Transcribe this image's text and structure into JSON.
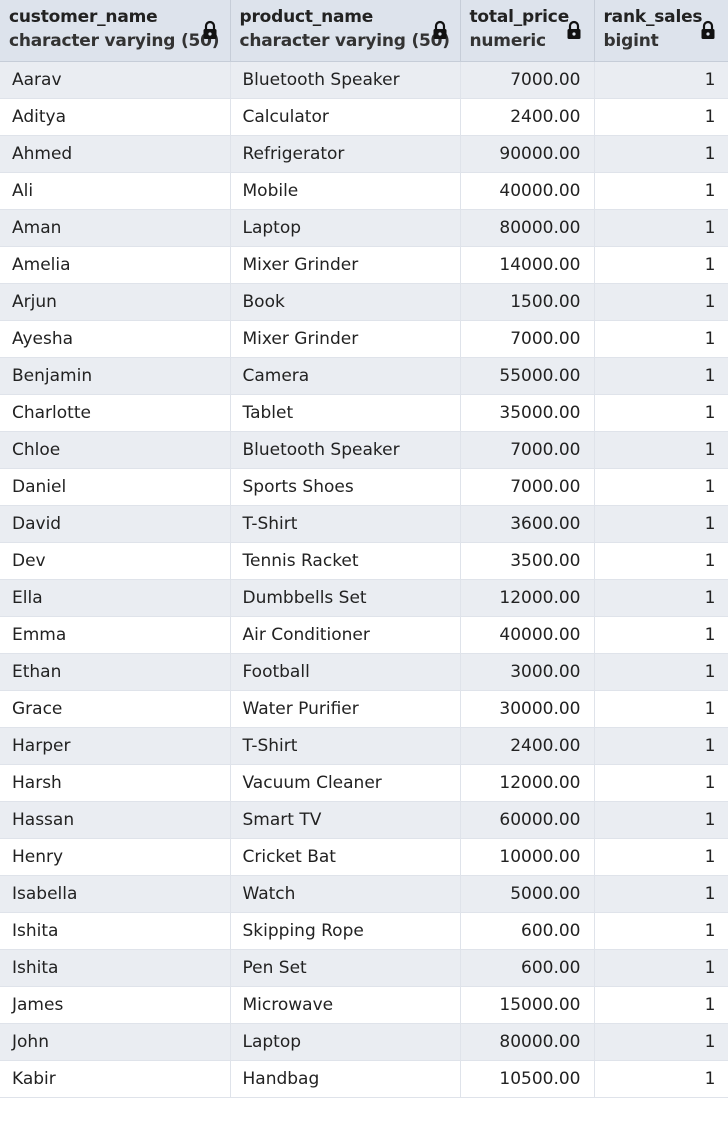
{
  "columns": [
    {
      "name": "customer_name",
      "type": "character varying (50)"
    },
    {
      "name": "product_name",
      "type": "character varying (50)"
    },
    {
      "name": "total_price",
      "type": "numeric"
    },
    {
      "name": "rank_sales",
      "type": "bigint"
    }
  ],
  "rows": [
    {
      "customer_name": "Aarav",
      "product_name": "Bluetooth Speaker",
      "total_price": "7000.00",
      "rank_sales": "1"
    },
    {
      "customer_name": "Aditya",
      "product_name": "Calculator",
      "total_price": "2400.00",
      "rank_sales": "1"
    },
    {
      "customer_name": "Ahmed",
      "product_name": "Refrigerator",
      "total_price": "90000.00",
      "rank_sales": "1"
    },
    {
      "customer_name": "Ali",
      "product_name": "Mobile",
      "total_price": "40000.00",
      "rank_sales": "1"
    },
    {
      "customer_name": "Aman",
      "product_name": "Laptop",
      "total_price": "80000.00",
      "rank_sales": "1"
    },
    {
      "customer_name": "Amelia",
      "product_name": "Mixer Grinder",
      "total_price": "14000.00",
      "rank_sales": "1"
    },
    {
      "customer_name": "Arjun",
      "product_name": "Book",
      "total_price": "1500.00",
      "rank_sales": "1"
    },
    {
      "customer_name": "Ayesha",
      "product_name": "Mixer Grinder",
      "total_price": "7000.00",
      "rank_sales": "1"
    },
    {
      "customer_name": "Benjamin",
      "product_name": "Camera",
      "total_price": "55000.00",
      "rank_sales": "1"
    },
    {
      "customer_name": "Charlotte",
      "product_name": "Tablet",
      "total_price": "35000.00",
      "rank_sales": "1"
    },
    {
      "customer_name": "Chloe",
      "product_name": "Bluetooth Speaker",
      "total_price": "7000.00",
      "rank_sales": "1"
    },
    {
      "customer_name": "Daniel",
      "product_name": "Sports Shoes",
      "total_price": "7000.00",
      "rank_sales": "1"
    },
    {
      "customer_name": "David",
      "product_name": "T-Shirt",
      "total_price": "3600.00",
      "rank_sales": "1"
    },
    {
      "customer_name": "Dev",
      "product_name": "Tennis Racket",
      "total_price": "3500.00",
      "rank_sales": "1"
    },
    {
      "customer_name": "Ella",
      "product_name": "Dumbbells Set",
      "total_price": "12000.00",
      "rank_sales": "1"
    },
    {
      "customer_name": "Emma",
      "product_name": "Air Conditioner",
      "total_price": "40000.00",
      "rank_sales": "1"
    },
    {
      "customer_name": "Ethan",
      "product_name": "Football",
      "total_price": "3000.00",
      "rank_sales": "1"
    },
    {
      "customer_name": "Grace",
      "product_name": "Water Purifier",
      "total_price": "30000.00",
      "rank_sales": "1"
    },
    {
      "customer_name": "Harper",
      "product_name": "T-Shirt",
      "total_price": "2400.00",
      "rank_sales": "1"
    },
    {
      "customer_name": "Harsh",
      "product_name": "Vacuum Cleaner",
      "total_price": "12000.00",
      "rank_sales": "1"
    },
    {
      "customer_name": "Hassan",
      "product_name": "Smart TV",
      "total_price": "60000.00",
      "rank_sales": "1"
    },
    {
      "customer_name": "Henry",
      "product_name": "Cricket Bat",
      "total_price": "10000.00",
      "rank_sales": "1"
    },
    {
      "customer_name": "Isabella",
      "product_name": "Watch",
      "total_price": "5000.00",
      "rank_sales": "1"
    },
    {
      "customer_name": "Ishita",
      "product_name": "Skipping Rope",
      "total_price": "600.00",
      "rank_sales": "1"
    },
    {
      "customer_name": "Ishita",
      "product_name": "Pen Set",
      "total_price": "600.00",
      "rank_sales": "1"
    },
    {
      "customer_name": "James",
      "product_name": "Microwave",
      "total_price": "15000.00",
      "rank_sales": "1"
    },
    {
      "customer_name": "John",
      "product_name": "Laptop",
      "total_price": "80000.00",
      "rank_sales": "1"
    },
    {
      "customer_name": "Kabir",
      "product_name": "Handbag",
      "total_price": "10500.00",
      "rank_sales": "1"
    }
  ],
  "icons": {
    "column_lock": "lock-icon"
  },
  "colors": {
    "header_bg": "#dde3ec",
    "row_alt_bg": "#eaedf2",
    "row_bg": "#ffffff"
  }
}
